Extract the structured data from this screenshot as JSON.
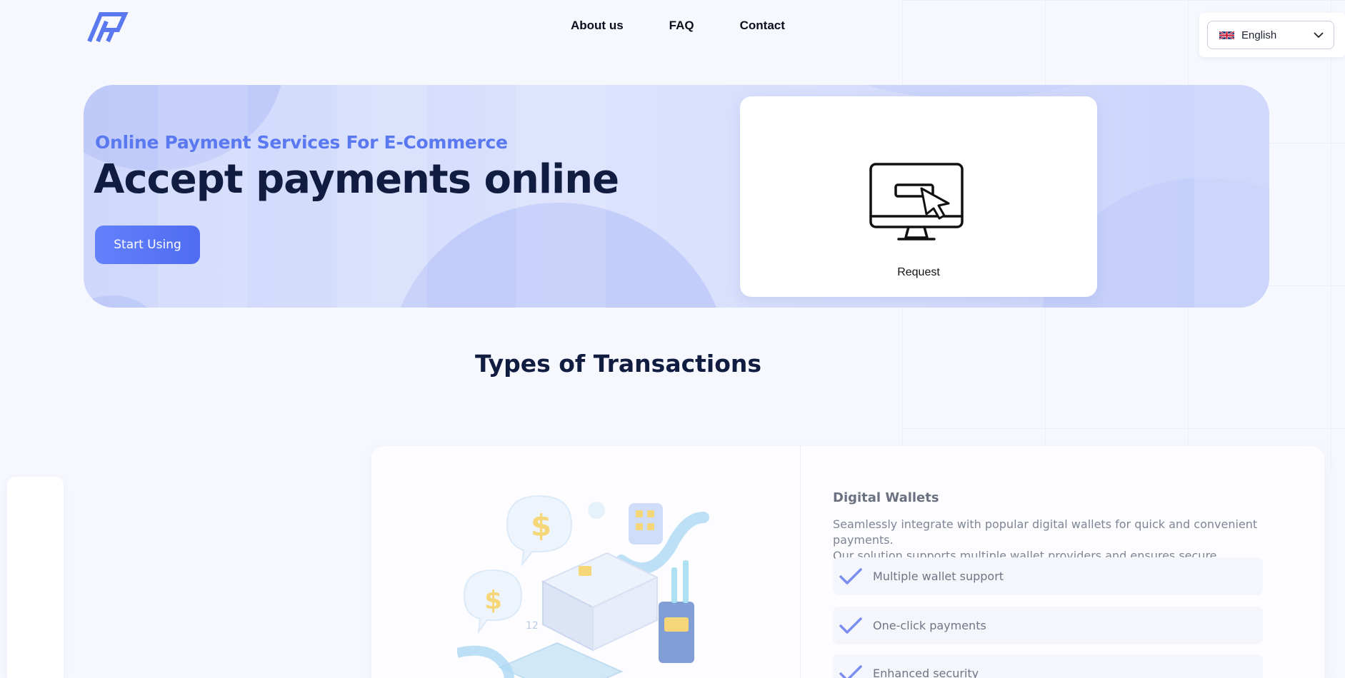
{
  "nav": {
    "items": [
      "About us",
      "FAQ",
      "Contact"
    ]
  },
  "language": {
    "selected": "English",
    "flag_icon": "uk-flag-icon"
  },
  "hero": {
    "subtitle": "Online Payment Services For E-Commerce",
    "title": "Accept payments online",
    "button": "Start Using",
    "card_label": "Request"
  },
  "section": {
    "title": "Types of Transactions"
  },
  "transaction": {
    "title": "Digital Wallets",
    "description_line1": "Seamlessly integrate with popular digital wallets for quick and convenient payments.",
    "description_line2": "Our solution supports multiple wallet providers and ensures secure transactions.",
    "features": [
      "Multiple wallet support",
      "One-click payments",
      "Enhanced security"
    ]
  },
  "colors": {
    "accent": "#5a78f0",
    "button_bg": "#5874f6",
    "heading": "#111c41",
    "hero_bg": "#d4dcfc",
    "check": "#7b8ef0"
  }
}
